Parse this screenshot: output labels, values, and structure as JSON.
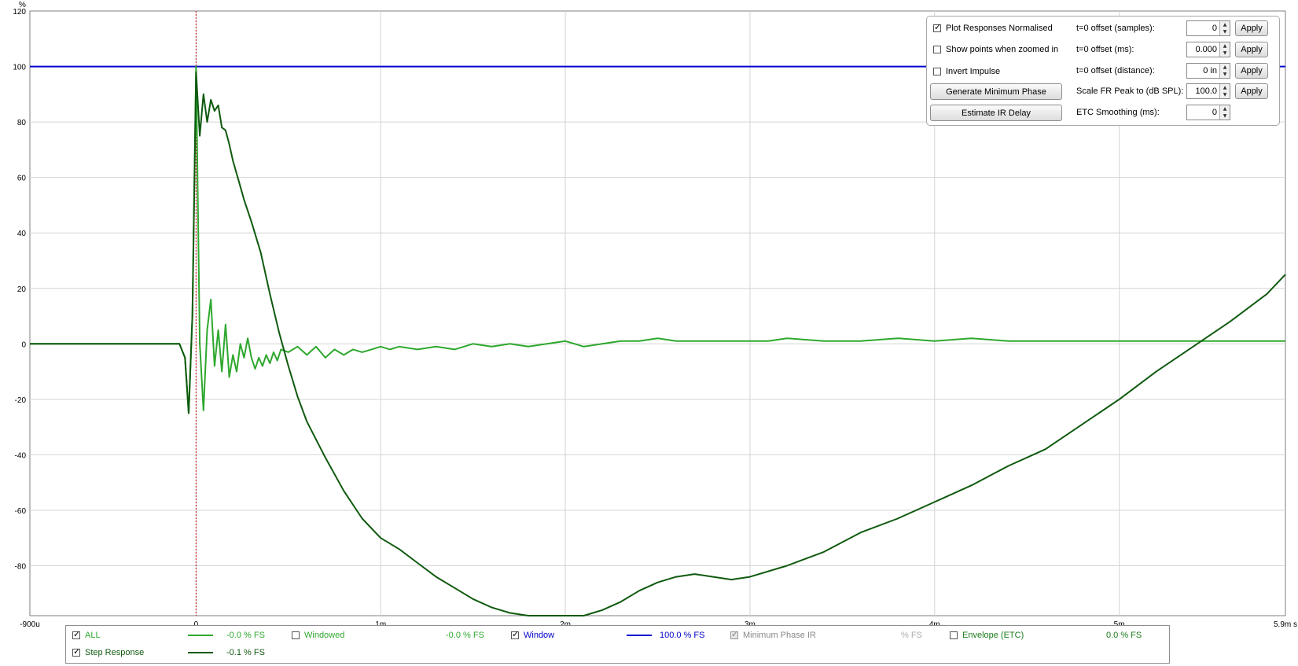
{
  "chart_data": {
    "type": "line",
    "title": "",
    "xlabel": "s",
    "ylabel": "%",
    "xlim": [
      -0.0009,
      0.0059
    ],
    "ylim": [
      -98,
      120
    ],
    "grid": true,
    "x_ticks": [
      {
        "v": -0.0009,
        "label": "-900u"
      },
      {
        "v": 0,
        "label": "0"
      },
      {
        "v": 0.001,
        "label": "1m"
      },
      {
        "v": 0.002,
        "label": "2m"
      },
      {
        "v": 0.003,
        "label": "3m"
      },
      {
        "v": 0.004,
        "label": "4m"
      },
      {
        "v": 0.005,
        "label": "5m"
      },
      {
        "v": 0.0059,
        "label": "5.9m s"
      }
    ],
    "y_ticks": [
      {
        "v": 120,
        "label": "120"
      },
      {
        "v": 100,
        "label": "100"
      },
      {
        "v": 80,
        "label": "80"
      },
      {
        "v": 60,
        "label": "60"
      },
      {
        "v": 40,
        "label": "40"
      },
      {
        "v": 20,
        "label": "20"
      },
      {
        "v": 0,
        "label": "0"
      },
      {
        "v": -20,
        "label": "-20"
      },
      {
        "v": -40,
        "label": "-40"
      },
      {
        "v": -60,
        "label": "-60"
      },
      {
        "v": -80,
        "label": "-80"
      }
    ],
    "y_unit_label": "%",
    "reference_time": 0,
    "series": [
      {
        "name": "ALL",
        "color": "#2ea82e",
        "x": [
          -0.0009,
          -0.0002,
          -9e-05,
          -6e-05,
          -4e-05,
          -2e-05,
          0,
          2e-05,
          4e-05,
          6e-05,
          8e-05,
          0.0001,
          0.00012,
          0.00014,
          0.00016,
          0.00018,
          0.0002,
          0.00022,
          0.00024,
          0.00026,
          0.00028,
          0.0003,
          0.00032,
          0.00034,
          0.00036,
          0.00038,
          0.0004,
          0.00042,
          0.00044,
          0.00046,
          0.0005,
          0.00055,
          0.0006,
          0.00065,
          0.0007,
          0.00075,
          0.0008,
          0.00085,
          0.0009,
          0.00095,
          0.001,
          0.00105,
          0.0011,
          0.0012,
          0.0013,
          0.0014,
          0.0015,
          0.0016,
          0.0017,
          0.0018,
          0.0019,
          0.002,
          0.0021,
          0.0022,
          0.0023,
          0.0024,
          0.0025,
          0.0026,
          0.0027,
          0.0028,
          0.0029,
          0.003,
          0.0031,
          0.0032,
          0.0034,
          0.0036,
          0.0038,
          0.004,
          0.0042,
          0.0044,
          0.0046,
          0.0048,
          0.005,
          0.0052,
          0.0054,
          0.0056,
          0.0059
        ],
        "y": [
          0,
          0,
          0,
          -5,
          -25,
          10,
          100,
          0,
          -24,
          5,
          16,
          -8,
          5,
          -10,
          7,
          -12,
          -4,
          -10,
          0,
          -5,
          2,
          -5,
          -9,
          -5,
          -8,
          -4,
          -7,
          -3,
          -6,
          -2,
          -3,
          -1,
          -4,
          -1,
          -5,
          -2,
          -4,
          -2,
          -3,
          -2,
          -1,
          -2,
          -1,
          -2,
          -1,
          -2,
          0,
          -1,
          0,
          -1,
          0,
          1,
          -1,
          0,
          1,
          1,
          2,
          1,
          1,
          1,
          1,
          1,
          1,
          2,
          1,
          1,
          2,
          1,
          2,
          1,
          1,
          1,
          1,
          1,
          1,
          1,
          1
        ]
      },
      {
        "name": "Step Response",
        "color": "#0f5a0f",
        "x": [
          -0.0009,
          -0.0002,
          -9e-05,
          -6e-05,
          -4e-05,
          -2e-05,
          0,
          2e-05,
          4e-05,
          6e-05,
          8e-05,
          0.0001,
          0.00012,
          0.00014,
          0.00016,
          0.00018,
          0.0002,
          0.00023,
          0.00026,
          0.0003,
          0.00035,
          0.0004,
          0.00045,
          0.0005,
          0.00055,
          0.0006,
          0.0007,
          0.0008,
          0.0009,
          0.001,
          0.0011,
          0.0012,
          0.0013,
          0.0014,
          0.0015,
          0.0016,
          0.0017,
          0.0018,
          0.0019,
          0.002,
          0.0021,
          0.0022,
          0.0023,
          0.0024,
          0.0025,
          0.0026,
          0.0027,
          0.0028,
          0.0029,
          0.003,
          0.0032,
          0.0034,
          0.0036,
          0.0038,
          0.004,
          0.0042,
          0.0044,
          0.0046,
          0.0048,
          0.005,
          0.0052,
          0.0054,
          0.0056,
          0.0058,
          0.0059
        ],
        "y": [
          0,
          0,
          0,
          -5,
          -25,
          10,
          98,
          75,
          90,
          80,
          88,
          84,
          86,
          78,
          77,
          72,
          66,
          59,
          52,
          44,
          33,
          18,
          4,
          -8,
          -19,
          -28,
          -41,
          -53,
          -63,
          -70,
          -74,
          -79,
          -84,
          -88,
          -92,
          -95,
          -97,
          -98,
          -98,
          -99,
          -99,
          -96,
          -93,
          -89,
          -86,
          -84,
          -83,
          -84,
          -85,
          -84,
          -80,
          -75,
          -68,
          -63,
          -57,
          -51,
          -44,
          -38,
          -29,
          -20,
          -10,
          -1,
          8,
          18,
          25
        ]
      },
      {
        "name": "Window",
        "color": "#0000cc",
        "x": [
          -0.0009,
          0.0059
        ],
        "y": [
          100,
          100
        ]
      }
    ]
  },
  "controls": {
    "plot_normalised_label": "Plot Responses Normalised",
    "plot_normalised_checked": true,
    "show_points_label": "Show points when zoomed in",
    "show_points_checked": false,
    "invert_impulse_label": "Invert Impulse",
    "invert_impulse_checked": false,
    "gen_min_phase_label": "Generate Minimum Phase",
    "estimate_ir_delay_label": "Estimate IR Delay",
    "offset_samples_label": "t=0 offset (samples):",
    "offset_samples_value": "0",
    "offset_ms_label": "t=0 offset (ms):",
    "offset_ms_value": "0.000",
    "offset_distance_label": "t=0 offset (distance):",
    "offset_distance_value": "0 in",
    "scale_fr_label": "Scale FR Peak to (dB SPL):",
    "scale_fr_value": "100.0",
    "etc_smoothing_label": "ETC Smoothing (ms):",
    "etc_smoothing_value": "0",
    "apply_label": "Apply",
    "spin_up": "▲",
    "spin_down": "▼"
  },
  "legend": {
    "items": [
      {
        "label": "ALL",
        "value": "-0.0 % FS",
        "checked": true,
        "color": "#2ea82e",
        "label_color": "#2ea82e"
      },
      {
        "label": "Windowed",
        "value": "-0.0 % FS",
        "checked": false,
        "color": "#2ea82e",
        "label_color": "#2ea82e"
      },
      {
        "label": "Window",
        "value": "100.0 % FS",
        "checked": true,
        "color": "#0000cc",
        "label_color": "#0000cc"
      },
      {
        "label": "Minimum Phase IR",
        "value": "% FS",
        "checked": true,
        "disabled": true,
        "color": "#999999",
        "label_color": "#888888"
      },
      {
        "label": "Envelope (ETC)",
        "value": "0.0 % FS",
        "checked": false,
        "color": "#2ea82e",
        "label_color": "#1a7a1a"
      },
      {
        "label": "Step Response",
        "value": "-0.1 % FS",
        "checked": true,
        "color": "#0f5a0f",
        "label_color": "#0f5a0f"
      }
    ]
  }
}
